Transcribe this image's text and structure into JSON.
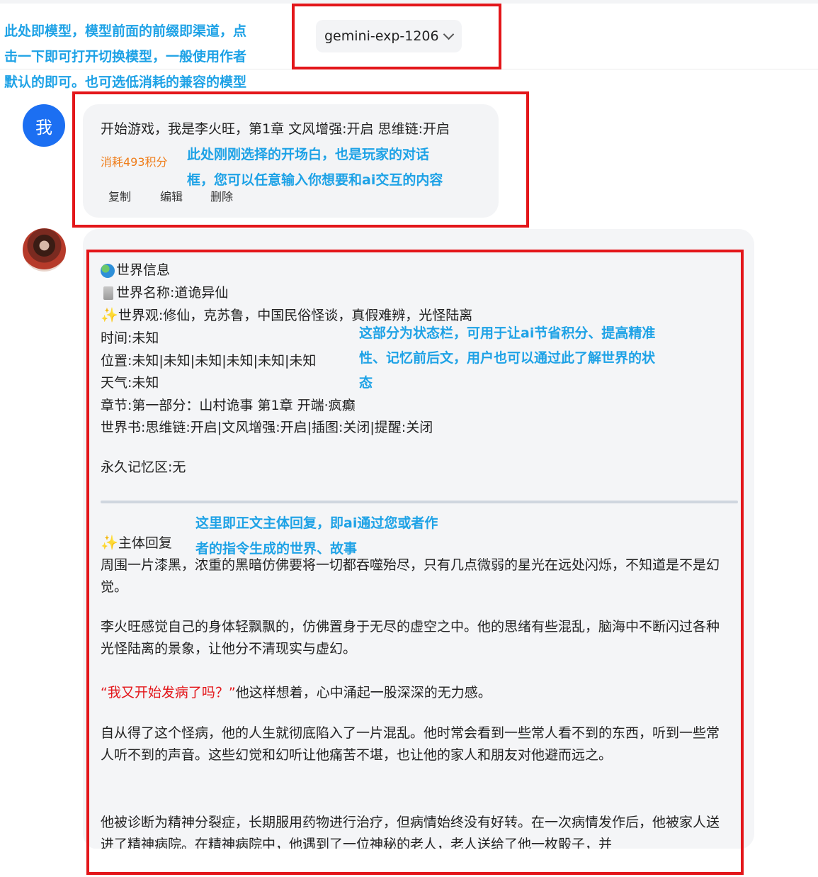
{
  "model": {
    "name": "gemini-exp-1206"
  },
  "annotations": {
    "model_note": [
      "此处即模型，模型前面的前缀即渠道，点",
      "击一下即可打开切换模型，一般使用作者",
      "默认的即可。也可选低消耗的兼容的模型"
    ],
    "user_note": [
      "此处刚刚选择的开场白，也是玩家的对话",
      "框，您可以任意输入你想要和ai交互的内容"
    ],
    "status_note": [
      "这部分为状态栏，可用于让ai节省积分、提高精准",
      "性、记忆前后文，用户也可以通过此了解世界的状",
      "态"
    ],
    "reply_note": [
      "这里即正文主体回复，即ai通过您或者作",
      "者的指令生成的世界、故事"
    ]
  },
  "user_message": {
    "avatar_label": "我",
    "text": "开始游戏，我是李火旺，第1章 文风增强:开启 思维链:开启",
    "cost": "消耗493积分",
    "actions": {
      "copy": "复制",
      "edit": "编辑",
      "delete": "删除"
    }
  },
  "ai_message": {
    "status": {
      "world_info": "世界信息",
      "world_name": "世界名称:道诡异仙",
      "worldview": "世界观:修仙，克苏鲁，中国民俗怪谈，真假难辨，光怪陆离",
      "time": "时间:未知",
      "location": "位置:未知|未知|未知|未知|未知|未知",
      "weather": "天气:未知",
      "chapter": "章节:第一部分：山村诡事 第1章 开端·疯癫",
      "worldbook": "世界书:思维链:开启|文风增强:开启|插图:关闭|提醒:关闭",
      "memory": "永久记忆区:无"
    },
    "reply_title": "主体回复",
    "paragraphs": {
      "p1": "周围一片漆黑，浓重的黑暗仿佛要将一切都吞噬殆尽，只有几点微弱的星光在远处闪烁，不知道是不是幻觉。",
      "p2": "李火旺感觉自己的身体轻飘飘的，仿佛置身于无尽的虚空之中。他的思绪有些混乱，脑海中不断闪过各种光怪陆离的景象，让他分不清现实与虚幻。",
      "p3_quote": "“我又开始发病了吗？”",
      "p3_rest": "他这样想着，心中涌起一股深深的无力感。",
      "p4": "自从得了这个怪病，他的人生就彻底陷入了一片混乱。他时常会看到一些常人看不到的东西，听到一些常人听不到的声音。这些幻觉和幻听让他痛苦不堪，也让他的家人和朋友对他避而远之。",
      "p5": "他被诊断为精神分裂症，长期服用药物进行治疗，但病情始终没有好转。在一次病情发作后，他被家人送进了精神病院。在精神病院中，他遇到了一位神秘的老人，老人送给了他一枚骰子，并"
    }
  }
}
